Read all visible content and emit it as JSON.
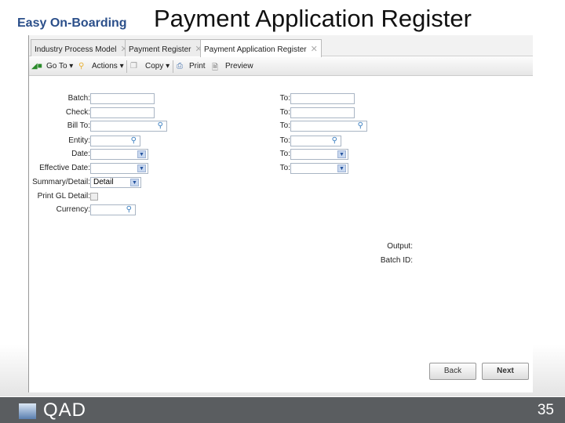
{
  "slide": {
    "subtitle": "Easy On-Boarding",
    "title": "Payment Application Register",
    "page_number": "35",
    "logo": "QAD"
  },
  "tabs": [
    {
      "label": "Industry Process Model",
      "active": false
    },
    {
      "label": "Payment Register",
      "active": false
    },
    {
      "label": "Payment Application Register",
      "active": true
    }
  ],
  "toolbar": {
    "goto": "Go To",
    "actions": "Actions",
    "copy": "Copy",
    "print": "Print",
    "preview": "Preview"
  },
  "form": {
    "left": [
      {
        "label": "Batch:",
        "type": "text",
        "value": ""
      },
      {
        "label": "Check:",
        "type": "text",
        "value": ""
      },
      {
        "label": "Bill To:",
        "type": "lookup",
        "value": ""
      },
      {
        "label": "Entity:",
        "type": "lookup",
        "value": ""
      },
      {
        "label": "Date:",
        "type": "dropdown",
        "value": ""
      },
      {
        "label": "Effective Date:",
        "type": "dropdown",
        "value": ""
      },
      {
        "label": "Summary/Detail:",
        "type": "dropdown",
        "value": "Detail"
      },
      {
        "label": "Print GL Detail:",
        "type": "checkbox",
        "checked": false
      },
      {
        "label": "Currency:",
        "type": "lookup",
        "value": ""
      }
    ],
    "right": [
      {
        "label": "To:",
        "type": "text",
        "value": ""
      },
      {
        "label": "To:",
        "type": "text",
        "value": ""
      },
      {
        "label": "To:",
        "type": "lookup",
        "value": ""
      },
      {
        "label": "To:",
        "type": "lookup",
        "value": ""
      },
      {
        "label": "To:",
        "type": "dropdown",
        "value": ""
      },
      {
        "label": "To:",
        "type": "dropdown",
        "value": ""
      }
    ],
    "output_label": "Output:",
    "batch_id_label": "Batch ID:"
  },
  "buttons": {
    "back": "Back",
    "next": "Next"
  }
}
